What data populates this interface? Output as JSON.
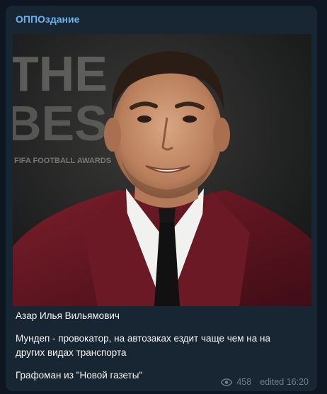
{
  "message": {
    "channel_name": "ОППОздание",
    "caption_lines": [
      "Азар Илья Вильямович",
      "Мундеп - провокатор, на автозаках ездит чаще чем на на",
      "других видах транспорта",
      "Графоман из \"Новой газеты\""
    ],
    "views": "458",
    "edited_time": "edited 16:20",
    "photo": {
      "backdrop_text_top": "THE",
      "backdrop_text_mid": "BES",
      "backdrop_text_logo": "FIFA FOOTBALL AWARDS",
      "icon": "portrait-photo"
    }
  },
  "colors": {
    "background": "#0e1621",
    "bubble": "#182533",
    "accent": "#6ab3f3",
    "meta": "#6d7f8f"
  }
}
